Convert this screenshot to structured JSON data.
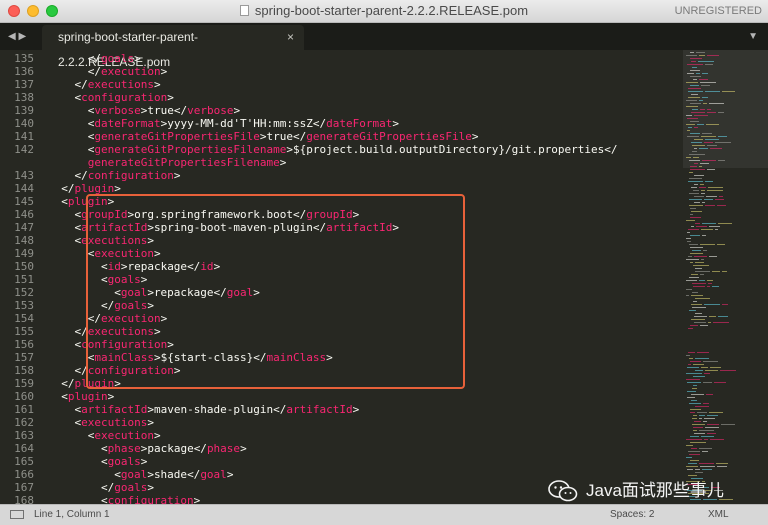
{
  "window": {
    "title": "spring-boot-starter-parent-2.2.2.RELEASE.pom",
    "unregistered": "UNREGISTERED"
  },
  "tabs": {
    "nav_left": "◀",
    "nav_right": "▶",
    "active_label": "spring-boot-starter-parent-2.2.2.RELEASE.pom",
    "close_glyph": "×",
    "menu_glyph": "▼"
  },
  "editor": {
    "lines": [
      {
        "n": "135",
        "indent": 3,
        "tokens": [
          [
            "p",
            "</"
          ],
          [
            "t",
            "goals"
          ],
          [
            "p",
            ">"
          ]
        ]
      },
      {
        "n": "136",
        "indent": 3,
        "tokens": [
          [
            "p",
            "</"
          ],
          [
            "t",
            "execution"
          ],
          [
            "p",
            ">"
          ]
        ]
      },
      {
        "n": "137",
        "indent": 2,
        "tokens": [
          [
            "p",
            "</"
          ],
          [
            "t",
            "executions"
          ],
          [
            "p",
            ">"
          ]
        ]
      },
      {
        "n": "138",
        "indent": 2,
        "tokens": [
          [
            "p",
            "<"
          ],
          [
            "t",
            "configuration"
          ],
          [
            "p",
            ">"
          ]
        ]
      },
      {
        "n": "139",
        "indent": 3,
        "tokens": [
          [
            "p",
            "<"
          ],
          [
            "t",
            "verbose"
          ],
          [
            "p",
            ">"
          ],
          [
            "x",
            "true"
          ],
          [
            "p",
            "</"
          ],
          [
            "t",
            "verbose"
          ],
          [
            "p",
            ">"
          ]
        ]
      },
      {
        "n": "140",
        "indent": 3,
        "tokens": [
          [
            "p",
            "<"
          ],
          [
            "t",
            "dateFormat"
          ],
          [
            "p",
            ">"
          ],
          [
            "x",
            "yyyy-MM-dd'T'HH:mm:ssZ"
          ],
          [
            "p",
            "</"
          ],
          [
            "t",
            "dateFormat"
          ],
          [
            "p",
            ">"
          ]
        ]
      },
      {
        "n": "141",
        "indent": 3,
        "tokens": [
          [
            "p",
            "<"
          ],
          [
            "t",
            "generateGitPropertiesFile"
          ],
          [
            "p",
            ">"
          ],
          [
            "x",
            "true"
          ],
          [
            "p",
            "</"
          ],
          [
            "t",
            "generateGitPropertiesFile"
          ],
          [
            "p",
            ">"
          ]
        ]
      },
      {
        "n": "142",
        "indent": 3,
        "tokens": [
          [
            "p",
            "<"
          ],
          [
            "t",
            "generateGitPropertiesFilename"
          ],
          [
            "p",
            ">"
          ],
          [
            "x",
            "${project.build.outputDirectory}/git.properties"
          ],
          [
            "p",
            "</"
          ]
        ]
      },
      {
        "n": "",
        "indent": 3,
        "tokens": [
          [
            "t",
            "generateGitPropertiesFilename"
          ],
          [
            "p",
            ">"
          ]
        ]
      },
      {
        "n": "143",
        "indent": 2,
        "tokens": [
          [
            "p",
            "</"
          ],
          [
            "t",
            "configuration"
          ],
          [
            "p",
            ">"
          ]
        ]
      },
      {
        "n": "144",
        "indent": 1,
        "tokens": [
          [
            "p",
            "</"
          ],
          [
            "t",
            "plugin"
          ],
          [
            "p",
            ">"
          ]
        ]
      },
      {
        "n": "145",
        "indent": 1,
        "tokens": [
          [
            "p",
            "<"
          ],
          [
            "t",
            "plugin"
          ],
          [
            "p",
            ">"
          ]
        ]
      },
      {
        "n": "146",
        "indent": 2,
        "tokens": [
          [
            "p",
            "<"
          ],
          [
            "t",
            "groupId"
          ],
          [
            "p",
            ">"
          ],
          [
            "x",
            "org.springframework.boot"
          ],
          [
            "p",
            "</"
          ],
          [
            "t",
            "groupId"
          ],
          [
            "p",
            ">"
          ]
        ]
      },
      {
        "n": "147",
        "indent": 2,
        "tokens": [
          [
            "p",
            "<"
          ],
          [
            "t",
            "artifactId"
          ],
          [
            "p",
            ">"
          ],
          [
            "x",
            "spring-boot-maven-plugin"
          ],
          [
            "p",
            "</"
          ],
          [
            "t",
            "artifactId"
          ],
          [
            "p",
            ">"
          ]
        ]
      },
      {
        "n": "148",
        "indent": 2,
        "tokens": [
          [
            "p",
            "<"
          ],
          [
            "t",
            "executions"
          ],
          [
            "p",
            ">"
          ]
        ]
      },
      {
        "n": "149",
        "indent": 3,
        "tokens": [
          [
            "p",
            "<"
          ],
          [
            "t",
            "execution"
          ],
          [
            "p",
            ">"
          ]
        ]
      },
      {
        "n": "150",
        "indent": 4,
        "tokens": [
          [
            "p",
            "<"
          ],
          [
            "t",
            "id"
          ],
          [
            "p",
            ">"
          ],
          [
            "x",
            "repackage"
          ],
          [
            "p",
            "</"
          ],
          [
            "t",
            "id"
          ],
          [
            "p",
            ">"
          ]
        ]
      },
      {
        "n": "151",
        "indent": 4,
        "tokens": [
          [
            "p",
            "<"
          ],
          [
            "t",
            "goals"
          ],
          [
            "p",
            ">"
          ]
        ]
      },
      {
        "n": "152",
        "indent": 5,
        "tokens": [
          [
            "p",
            "<"
          ],
          [
            "t",
            "goal"
          ],
          [
            "p",
            ">"
          ],
          [
            "x",
            "repackage"
          ],
          [
            "p",
            "</"
          ],
          [
            "t",
            "goal"
          ],
          [
            "p",
            ">"
          ]
        ]
      },
      {
        "n": "153",
        "indent": 4,
        "tokens": [
          [
            "p",
            "</"
          ],
          [
            "t",
            "goals"
          ],
          [
            "p",
            ">"
          ]
        ]
      },
      {
        "n": "154",
        "indent": 3,
        "tokens": [
          [
            "p",
            "</"
          ],
          [
            "t",
            "execution"
          ],
          [
            "p",
            ">"
          ]
        ]
      },
      {
        "n": "155",
        "indent": 2,
        "tokens": [
          [
            "p",
            "</"
          ],
          [
            "t",
            "executions"
          ],
          [
            "p",
            ">"
          ]
        ]
      },
      {
        "n": "156",
        "indent": 2,
        "tokens": [
          [
            "p",
            "<"
          ],
          [
            "t",
            "configuration"
          ],
          [
            "p",
            ">"
          ]
        ]
      },
      {
        "n": "157",
        "indent": 3,
        "tokens": [
          [
            "p",
            "<"
          ],
          [
            "t",
            "mainClass"
          ],
          [
            "p",
            ">"
          ],
          [
            "x",
            "${start-class}"
          ],
          [
            "p",
            "</"
          ],
          [
            "t",
            "mainClass"
          ],
          [
            "p",
            ">"
          ]
        ]
      },
      {
        "n": "158",
        "indent": 2,
        "tokens": [
          [
            "p",
            "</"
          ],
          [
            "t",
            "configuration"
          ],
          [
            "p",
            ">"
          ]
        ]
      },
      {
        "n": "159",
        "indent": 1,
        "tokens": [
          [
            "p",
            "</"
          ],
          [
            "t",
            "plugin"
          ],
          [
            "p",
            ">"
          ]
        ]
      },
      {
        "n": "160",
        "indent": 1,
        "tokens": [
          [
            "p",
            "<"
          ],
          [
            "t",
            "plugin"
          ],
          [
            "p",
            ">"
          ]
        ]
      },
      {
        "n": "161",
        "indent": 2,
        "tokens": [
          [
            "p",
            "<"
          ],
          [
            "t",
            "artifactId"
          ],
          [
            "p",
            ">"
          ],
          [
            "x",
            "maven-shade-plugin"
          ],
          [
            "p",
            "</"
          ],
          [
            "t",
            "artifactId"
          ],
          [
            "p",
            ">"
          ]
        ]
      },
      {
        "n": "162",
        "indent": 2,
        "tokens": [
          [
            "p",
            "<"
          ],
          [
            "t",
            "executions"
          ],
          [
            "p",
            ">"
          ]
        ]
      },
      {
        "n": "163",
        "indent": 3,
        "tokens": [
          [
            "p",
            "<"
          ],
          [
            "t",
            "execution"
          ],
          [
            "p",
            ">"
          ]
        ]
      },
      {
        "n": "164",
        "indent": 4,
        "tokens": [
          [
            "p",
            "<"
          ],
          [
            "t",
            "phase"
          ],
          [
            "p",
            ">"
          ],
          [
            "x",
            "package"
          ],
          [
            "p",
            "</"
          ],
          [
            "t",
            "phase"
          ],
          [
            "p",
            ">"
          ]
        ]
      },
      {
        "n": "165",
        "indent": 4,
        "tokens": [
          [
            "p",
            "<"
          ],
          [
            "t",
            "goals"
          ],
          [
            "p",
            ">"
          ]
        ]
      },
      {
        "n": "166",
        "indent": 5,
        "tokens": [
          [
            "p",
            "<"
          ],
          [
            "t",
            "goal"
          ],
          [
            "p",
            ">"
          ],
          [
            "x",
            "shade"
          ],
          [
            "p",
            "</"
          ],
          [
            "t",
            "goal"
          ],
          [
            "p",
            ">"
          ]
        ]
      },
      {
        "n": "167",
        "indent": 4,
        "tokens": [
          [
            "p",
            "</"
          ],
          [
            "t",
            "goals"
          ],
          [
            "p",
            ">"
          ]
        ]
      },
      {
        "n": "168",
        "indent": 4,
        "tokens": [
          [
            "p",
            "<"
          ],
          [
            "t",
            "configuration"
          ],
          [
            "p",
            ">"
          ]
        ]
      }
    ]
  },
  "status": {
    "position": "Line 1, Column 1",
    "spaces": "Spaces: 2",
    "syntax": "XML"
  },
  "watermark": {
    "text": "Java面试那些事儿"
  },
  "colors": {
    "background": "#272822",
    "tag": "#f92672",
    "text": "#f8f8f2",
    "highlight_box": "#e8613a"
  }
}
